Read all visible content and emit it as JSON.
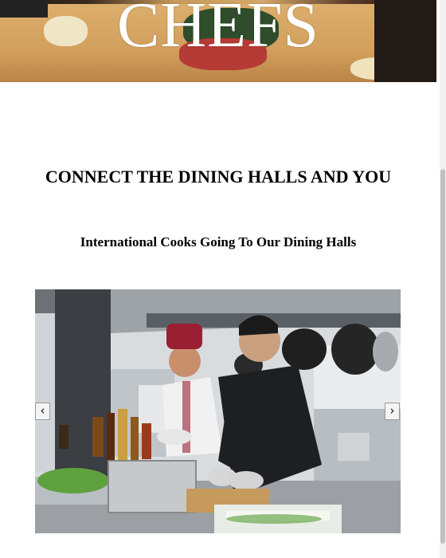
{
  "hero": {
    "title": "CHEFS"
  },
  "section": {
    "heading": "CONNECT THE DINING HALLS AND YOU",
    "subheading": "International Cooks Going To Our Dining Halls"
  },
  "slider": {
    "prev_icon": "chevron-left-icon",
    "next_icon": "chevron-right-icon",
    "prev_glyph": "‹",
    "next_glyph": "›"
  }
}
